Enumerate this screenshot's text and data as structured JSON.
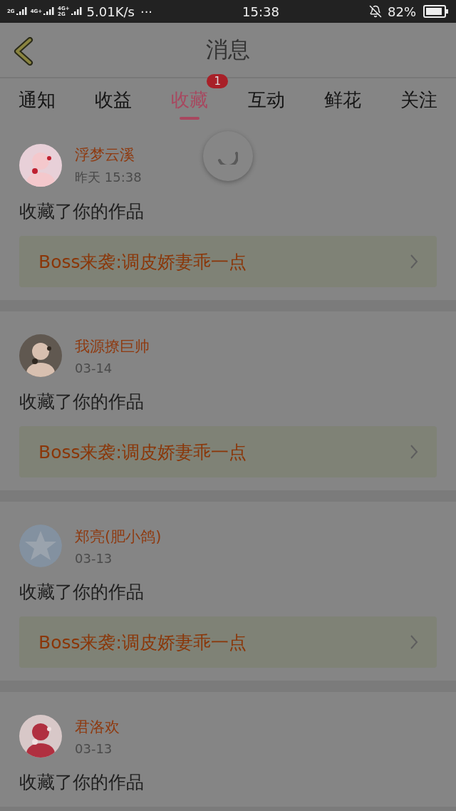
{
  "status_bar": {
    "signals": [
      {
        "labels": [
          "2G"
        ]
      },
      {
        "labels": [
          "4G+"
        ]
      },
      {
        "labels": [
          "4G+",
          "2G"
        ]
      }
    ],
    "speed": "5.01K/s",
    "more": "···",
    "time": "15:38",
    "battery": "82%"
  },
  "header": {
    "title": "消息"
  },
  "tabs": [
    {
      "label": "通知",
      "selected": false
    },
    {
      "label": "收益",
      "selected": false
    },
    {
      "label": "收藏",
      "selected": true,
      "badge": "1"
    },
    {
      "label": "互动",
      "selected": false
    },
    {
      "label": "鲜花",
      "selected": false
    },
    {
      "label": "关注",
      "selected": false
    }
  ],
  "loading": true,
  "messages": [
    {
      "name": "浮梦云溪",
      "time": "昨天 15:38",
      "text": "收藏了你的作品",
      "work": "Boss来袭:调皮娇妻乖一点"
    },
    {
      "name": "我源撩巨帅",
      "time": "03-14",
      "text": "收藏了你的作品",
      "work": "Boss来袭:调皮娇妻乖一点"
    },
    {
      "avatar": {
        "kind": "default"
      },
      "name": "郑亮(肥小鸽)",
      "time": "03-13",
      "text": "收藏了你的作品",
      "work": "Boss来袭:调皮娇妻乖一点"
    },
    {
      "name": "君洛欢",
      "time": "03-13",
      "text": "收藏了你的作品"
    }
  ]
}
